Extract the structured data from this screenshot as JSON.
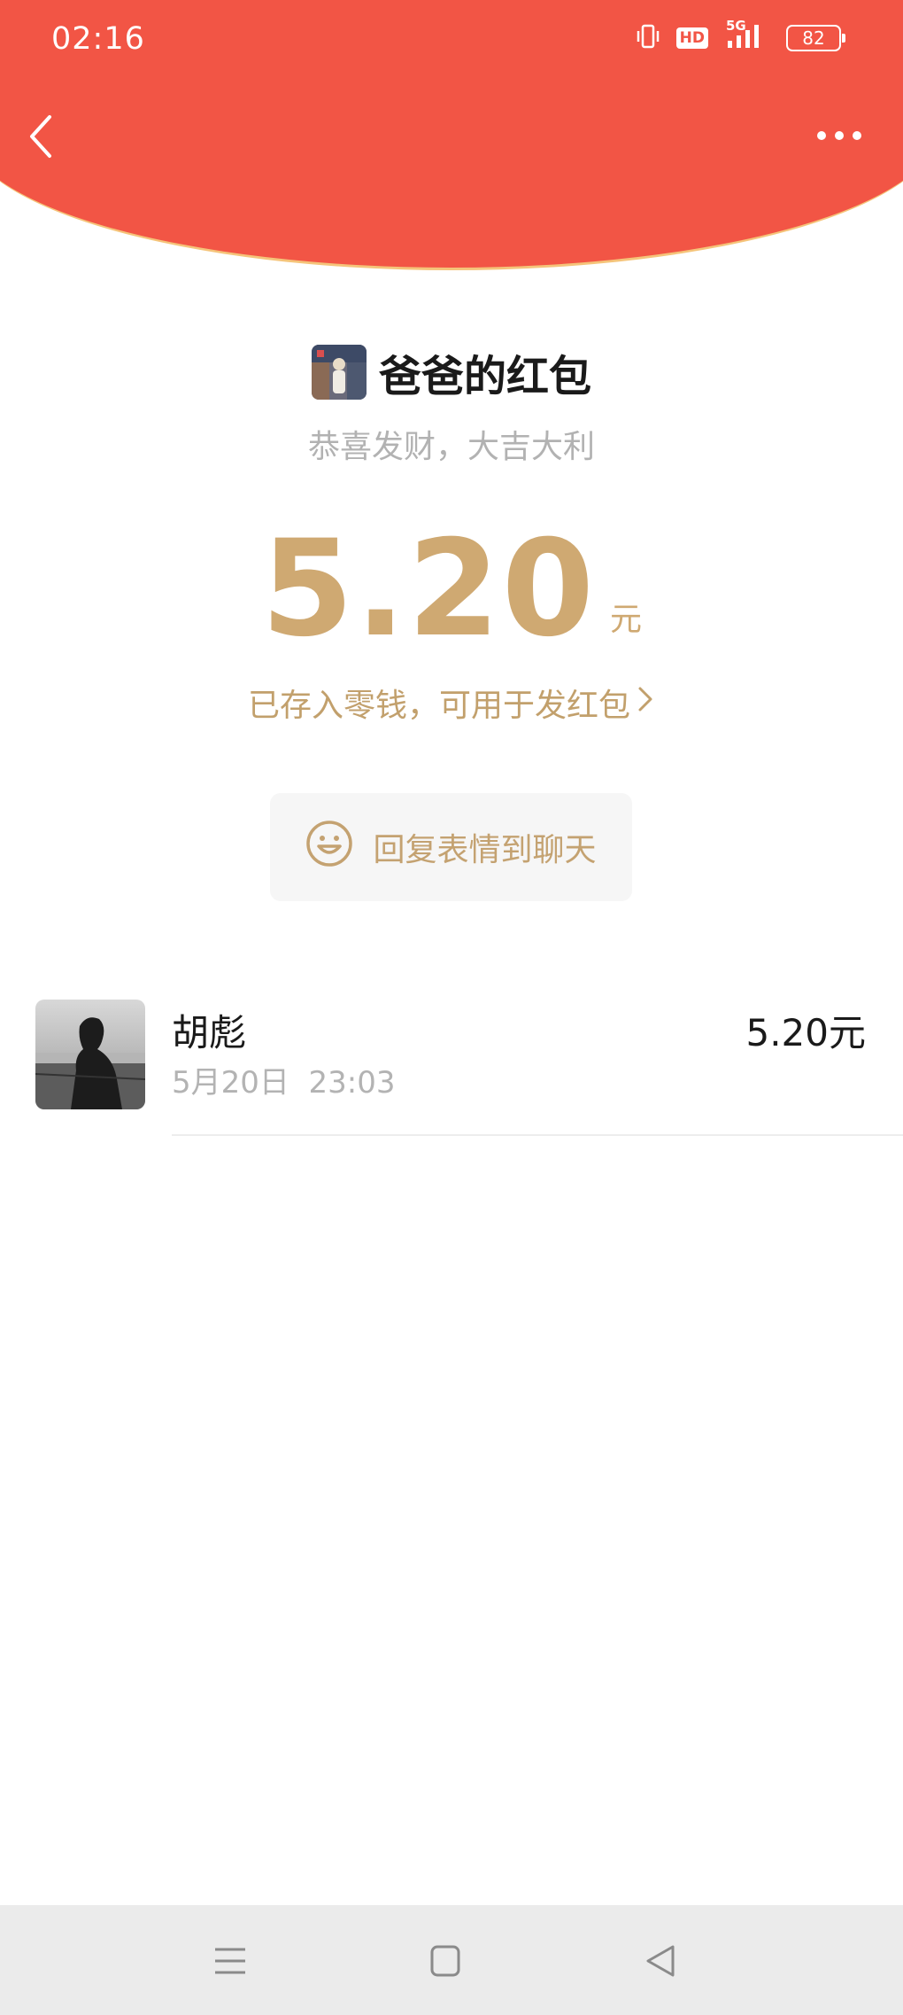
{
  "status_bar": {
    "time": "02:16",
    "hd_label": "HD",
    "network_label": "5G",
    "battery_level": "82",
    "icons": [
      "vibrate-icon",
      "hd-icon",
      "signal-5g-icon",
      "battery-icon"
    ]
  },
  "header": {
    "back_icon": "chevron-left-icon",
    "more_icon": "more-dots-icon",
    "color": "#f25545",
    "border_color": "#f5c47a"
  },
  "envelope": {
    "title": "爸爸的红包",
    "blessing": "恭喜发财，大吉大利",
    "amount": "5.20",
    "unit": "元",
    "saved_text": "已存入零钱，可用于发红包",
    "accent_color": "#cfa972"
  },
  "reply": {
    "label": "回复表情到聊天",
    "icon": "smiley-icon"
  },
  "records": [
    {
      "name": "胡彪",
      "time": "5月20日  23:03",
      "amount": "5.20元"
    }
  ],
  "nav": {
    "icons": [
      "menu-icon",
      "home-square-icon",
      "back-triangle-icon"
    ]
  }
}
